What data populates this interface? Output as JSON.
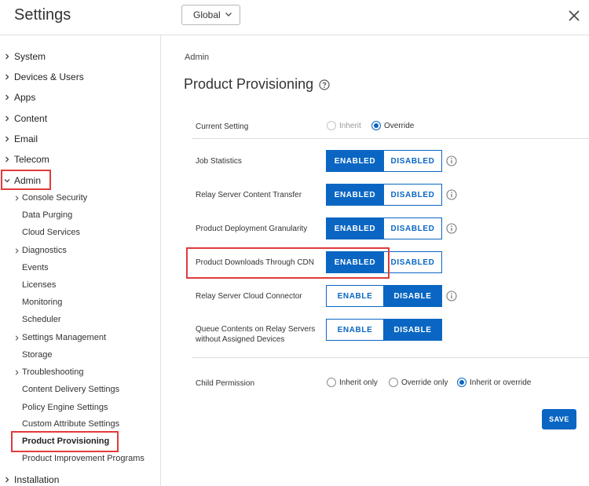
{
  "header": {
    "title": "Settings",
    "scope_dropdown": "Global"
  },
  "sidebar": {
    "top_items": [
      {
        "label": "System"
      },
      {
        "label": "Devices & Users"
      },
      {
        "label": "Apps"
      },
      {
        "label": "Content"
      },
      {
        "label": "Email"
      },
      {
        "label": "Telecom"
      },
      {
        "label": "Admin"
      },
      {
        "label": "Installation"
      }
    ],
    "admin_children": [
      {
        "label": "Console Security"
      },
      {
        "label": "Data Purging"
      },
      {
        "label": "Cloud Services"
      },
      {
        "label": "Diagnostics"
      },
      {
        "label": "Events"
      },
      {
        "label": "Licenses"
      },
      {
        "label": "Monitoring"
      },
      {
        "label": "Scheduler"
      },
      {
        "label": "Settings Management"
      },
      {
        "label": "Storage"
      },
      {
        "label": "Troubleshooting"
      },
      {
        "label": "Content Delivery Settings"
      },
      {
        "label": "Policy Engine Settings"
      },
      {
        "label": "Custom Attribute Settings"
      },
      {
        "label": "Product Provisioning"
      },
      {
        "label": "Product Improvement Programs"
      }
    ]
  },
  "main": {
    "breadcrumb": "Admin",
    "title": "Product Provisioning",
    "current_setting": {
      "label": "Current Setting",
      "options": [
        "Inherit",
        "Override"
      ],
      "selected": "Override"
    },
    "rows": [
      {
        "label": "Job Statistics",
        "on_label": "ENABLED",
        "off_label": "DISABLED",
        "selected": "ENABLED"
      },
      {
        "label": "Relay Server Content Transfer",
        "on_label": "ENABLED",
        "off_label": "DISABLED",
        "selected": "ENABLED"
      },
      {
        "label": "Product Deployment Granularity",
        "on_label": "ENABLED",
        "off_label": "DISABLED",
        "selected": "ENABLED"
      },
      {
        "label": "Product Downloads Through CDN",
        "on_label": "ENABLED",
        "off_label": "DISABLED",
        "selected": "ENABLED"
      },
      {
        "label": "Relay Server Cloud Connector",
        "on_label": "ENABLE",
        "off_label": "DISABLE",
        "selected": "DISABLE"
      },
      {
        "label_line1": "Queue Contents on Relay Servers",
        "label_line2": "without Assigned Devices",
        "on_label": "ENABLE",
        "off_label": "DISABLE",
        "selected": "DISABLE"
      }
    ],
    "child_permission": {
      "label": "Child Permission",
      "options": [
        "Inherit only",
        "Override only",
        "Inherit or override"
      ],
      "selected": "Inherit or override"
    },
    "save_label": "SAVE"
  },
  "colors": {
    "accent": "#0a66c2",
    "highlight": "#e03c3c"
  }
}
